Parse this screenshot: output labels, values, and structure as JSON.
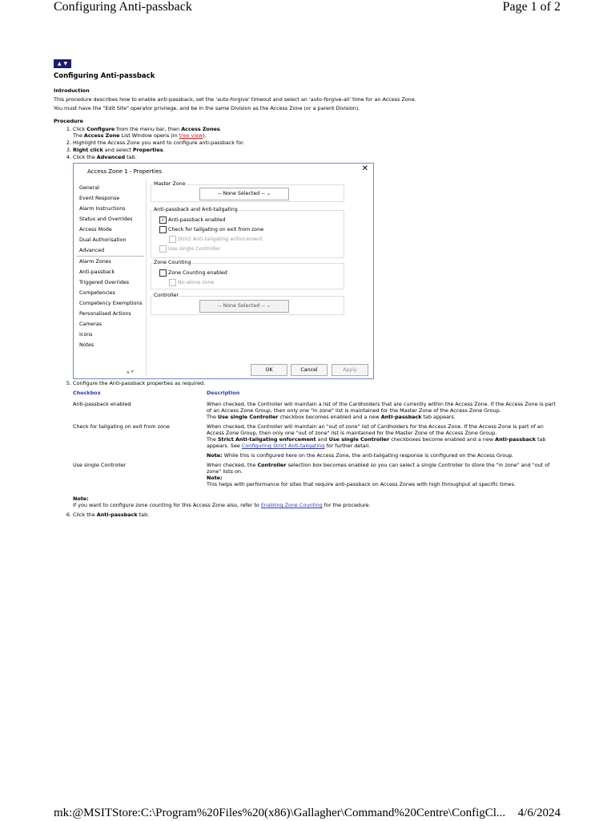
{
  "header": {
    "title": "Configuring Anti-passback",
    "page": "Page 1 of 2"
  },
  "nav_icons": {
    "up": "▲",
    "down": "▼"
  },
  "title": "Configuring Anti-passback",
  "introduction": {
    "heading": "Introduction",
    "para1": "This procedure describes how to enable anti-passback, set the 'auto-forgive' timeout and select an 'auto-forgive-all' time for an Access Zone.",
    "para2": "You must have the \"Edit Site\" operator privilege, and be in the same Division as the Access Zone (or a parent Division)."
  },
  "procedure": {
    "heading": "Procedure",
    "step1_a": "Click ",
    "step1_b": "Configure",
    "step1_c": " from the menu bar, then ",
    "step1_d": "Access Zones",
    "step1_e": ".",
    "step1_line2_a": "The ",
    "step1_line2_b": "Access Zone",
    "step1_line2_c": " List Window opens (in ",
    "step1_link": "tree view",
    "step1_line2_d": ").",
    "step2": "Highlight the Access Zone you want to configure anti-passback for.",
    "step3_a": "Right click",
    "step3_b": " and select ",
    "step3_c": "Properties",
    "step3_d": ".",
    "step4_a": "Click the ",
    "step4_b": "Advanced",
    "step4_c": " tab.",
    "step5": "Configure the Anti-passback properties as required.",
    "step6_a": "Click the ",
    "step6_b": "Anti-passback",
    "step6_c": " tab."
  },
  "dialog": {
    "title": "Access Zone 1 - Properties",
    "close": "✕",
    "list": [
      "General",
      "Event Response",
      "Alarm Instructions",
      "Status and Overrides",
      "Access Mode",
      "Dual Authorisation",
      "Advanced",
      "Alarm Zones",
      "Anti-passback",
      "Triggered Overrides",
      "Competencies",
      "Competency Exemptions",
      "Personalised Actions",
      "Cameras",
      "Icons",
      "Notes"
    ],
    "list_arrows": "▲ ▼",
    "master_zone": {
      "label": "Master Zone",
      "value": "-- None Selected --"
    },
    "apb_group": {
      "label": "Anti-passback and Anti-tailgating",
      "apb_enabled": "Anti-passback enabled",
      "check_tailgating": "Check for tailgating on exit from zone",
      "strict": "Strict Anti-tailgating enforcement",
      "single_controller": "Use single Controller"
    },
    "zone_counting": {
      "label": "Zone Counting",
      "enabled": "Zone Counting enabled",
      "no_alone": "No-alone zone"
    },
    "controller": {
      "label": "Controller",
      "value": "-- None Selected --"
    },
    "buttons": {
      "ok": "OK",
      "cancel": "Cancel",
      "apply": "Apply"
    }
  },
  "table": {
    "headers": [
      "Checkbox",
      "Description"
    ],
    "row1": {
      "name": "Anti-passback enabled",
      "d1": "When checked, the Controller will maintain a list of the Cardholders that are currently within the Access Zone. If the Access Zone is part of an Access Zone Group, then only one \"in zone\" list is maintained for the Master Zone of the Access Zone Group.",
      "d2_a": "The ",
      "d2_b": "Use single Controller",
      "d2_c": " checkbox becomes enabled and a new ",
      "d2_d": "Anti-passback",
      "d2_e": " tab appears."
    },
    "row2": {
      "name": "Check for tailgating on exit from zone",
      "d1": "When checked, the Controller will maintain an \"out of zone\" list of Cardholders for the Access Zone. If the Access Zone is part of an Access Zone Group, then only one \"out of zone\" list is maintained for the Master Zone of the Access Zone Group.",
      "d2_a": "The ",
      "d2_b": "Strict Anti-tailgating enforcement",
      "d2_c": " and ",
      "d2_d": "Use single Controller",
      "d2_e": " checkboxes become enabled and a new ",
      "d2_f": "Anti-passback",
      "d2_g": " tab appears. See ",
      "d2_link": "Configuring Strict Anti-tailgating",
      "d2_h": " for further detail.",
      "note_label": "Note:",
      "note_text": " While this is configured here on the Access Zone, the anti-tailgating response is configured on the Access Group."
    },
    "row3": {
      "name": "Use single Controller",
      "d1_a": "When checked, the ",
      "d1_b": "Controller",
      "d1_c": " selection box becomes enabled so you can select a single Controller to store the \"in zone\" and \"out of zone\" lists on.",
      "note_label": "Note:",
      "note_text": "This helps with performance for sites that require anti-passback on Access Zones with high throughput at specific times."
    }
  },
  "note_after": {
    "label": "Note:",
    "text_a": "If you want to configure zone counting for this Access Zone also, refer to ",
    "link": "Enabling Zone Counting",
    "text_b": " for the procedure."
  },
  "footer": {
    "path": "mk:@MSITStore:C:\\Program%20Files%20(x86)\\Gallagher\\Command%20Centre\\ConfigCl...",
    "date": "4/6/2024"
  }
}
